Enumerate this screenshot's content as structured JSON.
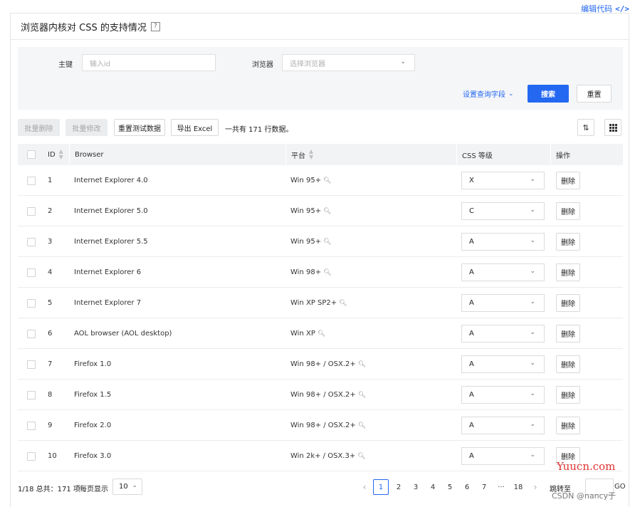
{
  "top_link": {
    "label": "编辑代码",
    "icon": "code-icon",
    "glyph": "</>"
  },
  "panel": {
    "title": "浏览器内核对 CSS 的支持情况",
    "help_glyph": "?"
  },
  "query": {
    "id_label": "主键",
    "id_placeholder": "输入id",
    "browser_label": "浏览器",
    "browser_placeholder": "选择浏览器",
    "set_fields": "设置查询字段",
    "search": "搜索",
    "reset": "重置"
  },
  "toolbar": {
    "batch_delete": "批量删除",
    "batch_edit": "批量修改",
    "reset_test_data": "重置测试数据",
    "export_excel": "导出 Excel",
    "total_text": "一共有 171 行数据。"
  },
  "table": {
    "headers": {
      "id": "ID",
      "browser": "Browser",
      "platform": "平台",
      "css_grade": "CSS 等级",
      "actions": "操作"
    },
    "delete_label": "删除",
    "rows": [
      {
        "id": "1",
        "browser": "Internet Explorer 4.0",
        "platform": "Win 95+",
        "grade": "X"
      },
      {
        "id": "2",
        "browser": "Internet Explorer 5.0",
        "platform": "Win 95+",
        "grade": "C"
      },
      {
        "id": "3",
        "browser": "Internet Explorer 5.5",
        "platform": "Win 95+",
        "grade": "A"
      },
      {
        "id": "4",
        "browser": "Internet Explorer 6",
        "platform": "Win 98+",
        "grade": "A"
      },
      {
        "id": "5",
        "browser": "Internet Explorer 7",
        "platform": "Win XP SP2+",
        "grade": "A"
      },
      {
        "id": "6",
        "browser": "AOL browser (AOL desktop)",
        "platform": "Win XP",
        "grade": "A"
      },
      {
        "id": "7",
        "browser": "Firefox 1.0",
        "platform": "Win 98+ / OSX.2+",
        "grade": "A"
      },
      {
        "id": "8",
        "browser": "Firefox 1.5",
        "platform": "Win 98+ / OSX.2+",
        "grade": "A"
      },
      {
        "id": "9",
        "browser": "Firefox 2.0",
        "platform": "Win 98+ / OSX.2+",
        "grade": "A"
      },
      {
        "id": "10",
        "browser": "Firefox 3.0",
        "platform": "Win 2k+ / OSX.3+",
        "grade": "A"
      }
    ]
  },
  "footer": {
    "summary": "1/18 总共：171 项",
    "per_page_label": "每页显示",
    "per_page_value": "10",
    "pages": [
      "1",
      "2",
      "3",
      "4",
      "5",
      "6",
      "7",
      "···",
      "18"
    ],
    "current_page": "1",
    "jump_label": "跳转至",
    "go_label": "GO"
  },
  "watermarks": {
    "site": "Yuucn.com",
    "author": "CSDN @nancy于"
  },
  "colors": {
    "primary": "#2468f2",
    "header_bg": "#f2f3f5",
    "query_bg": "#f5f6f8",
    "watermark_red": "#e03131"
  }
}
